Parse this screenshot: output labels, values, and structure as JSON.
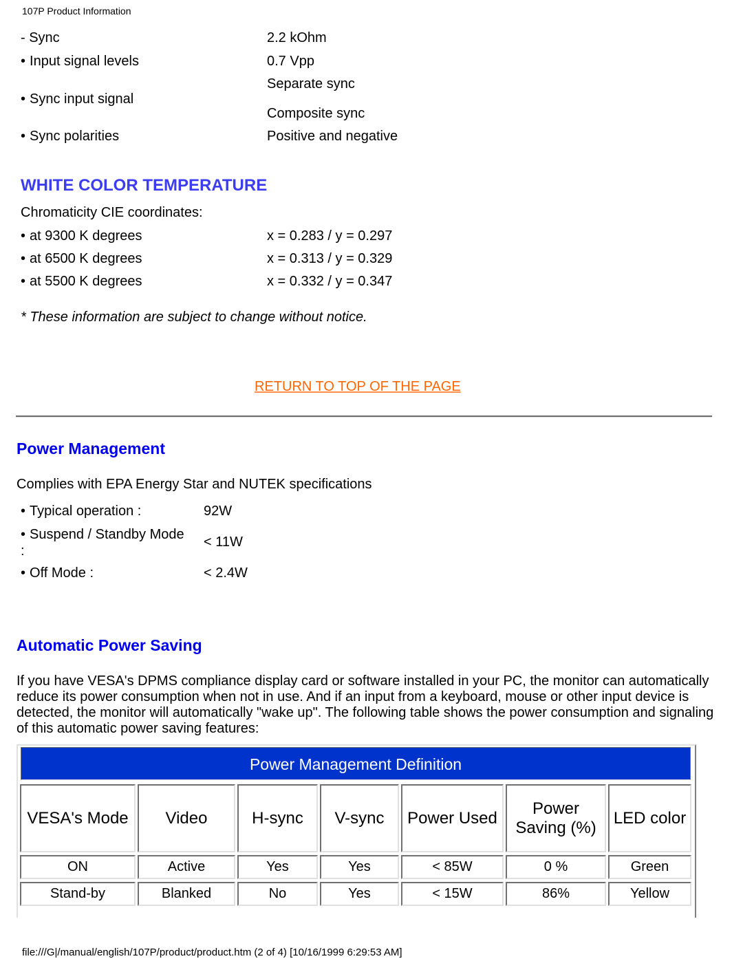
{
  "header": {
    "title": "107P Product Information"
  },
  "sync_specs": [
    {
      "label": "- Sync",
      "bullet": false,
      "values": [
        "2.2 kOhm"
      ]
    },
    {
      "label": "Input signal levels",
      "bullet": true,
      "values": [
        "0.7 Vpp"
      ]
    },
    {
      "label": "Sync input signal",
      "bullet": true,
      "values": [
        "Separate sync",
        "Composite sync"
      ]
    },
    {
      "label": "Sync polarities",
      "bullet": true,
      "values": [
        "Positive and negative"
      ]
    }
  ],
  "white_color_temperature": {
    "heading": "WHITE COLOR TEMPERATURE",
    "intro": "Chromaticity CIE coordinates:",
    "rows": [
      {
        "label": "at 9300 K degrees",
        "value": "x = 0.283 / y = 0.297"
      },
      {
        "label": "at 6500 K degrees",
        "value": "x = 0.313 / y = 0.329"
      },
      {
        "label": "at 5500 K degrees",
        "value": "x = 0.332 / y = 0.347"
      }
    ],
    "note": "* These information are subject to change without notice."
  },
  "return_link": "RETURN TO TOP OF THE PAGE",
  "power_management": {
    "heading": "Power Management",
    "intro": "Complies with EPA Energy Star and NUTEK specifications",
    "rows": [
      {
        "label": "Typical operation :",
        "value": "92W"
      },
      {
        "label": "Suspend / Standby Mode",
        "label_cont": ":",
        "value": "< 11W"
      },
      {
        "label": "Off Mode :",
        "value": "< 2.4W"
      }
    ]
  },
  "automatic_power_saving": {
    "heading": "Automatic Power Saving",
    "paragraph": "If you have VESA's DPMS compliance display card or software installed in your PC, the monitor can automatically reduce its power consumption when not in use. And if an input from a keyboard, mouse or other input device is detected, the monitor will automatically \"wake up\". The following table shows the power consumption and signaling of this automatic power saving features:"
  },
  "pm_table": {
    "title": "Power Management Definition",
    "header_color": "#0033cc",
    "columns": [
      "VESA's Mode",
      "Video",
      "H-sync",
      "V-sync",
      "Power Used",
      "Power Saving (%)",
      "LED color"
    ],
    "rows": [
      [
        "ON",
        "Active",
        "Yes",
        "Yes",
        "< 85W",
        "0 %",
        "Green"
      ],
      [
        "Stand-by",
        "Blanked",
        "No",
        "Yes",
        "< 15W",
        "86%",
        "Yellow"
      ]
    ]
  },
  "footer": {
    "path": "file:///G|/manual/english/107P/product/product.htm (2 of 4) [10/16/1999 6:29:53 AM]"
  }
}
